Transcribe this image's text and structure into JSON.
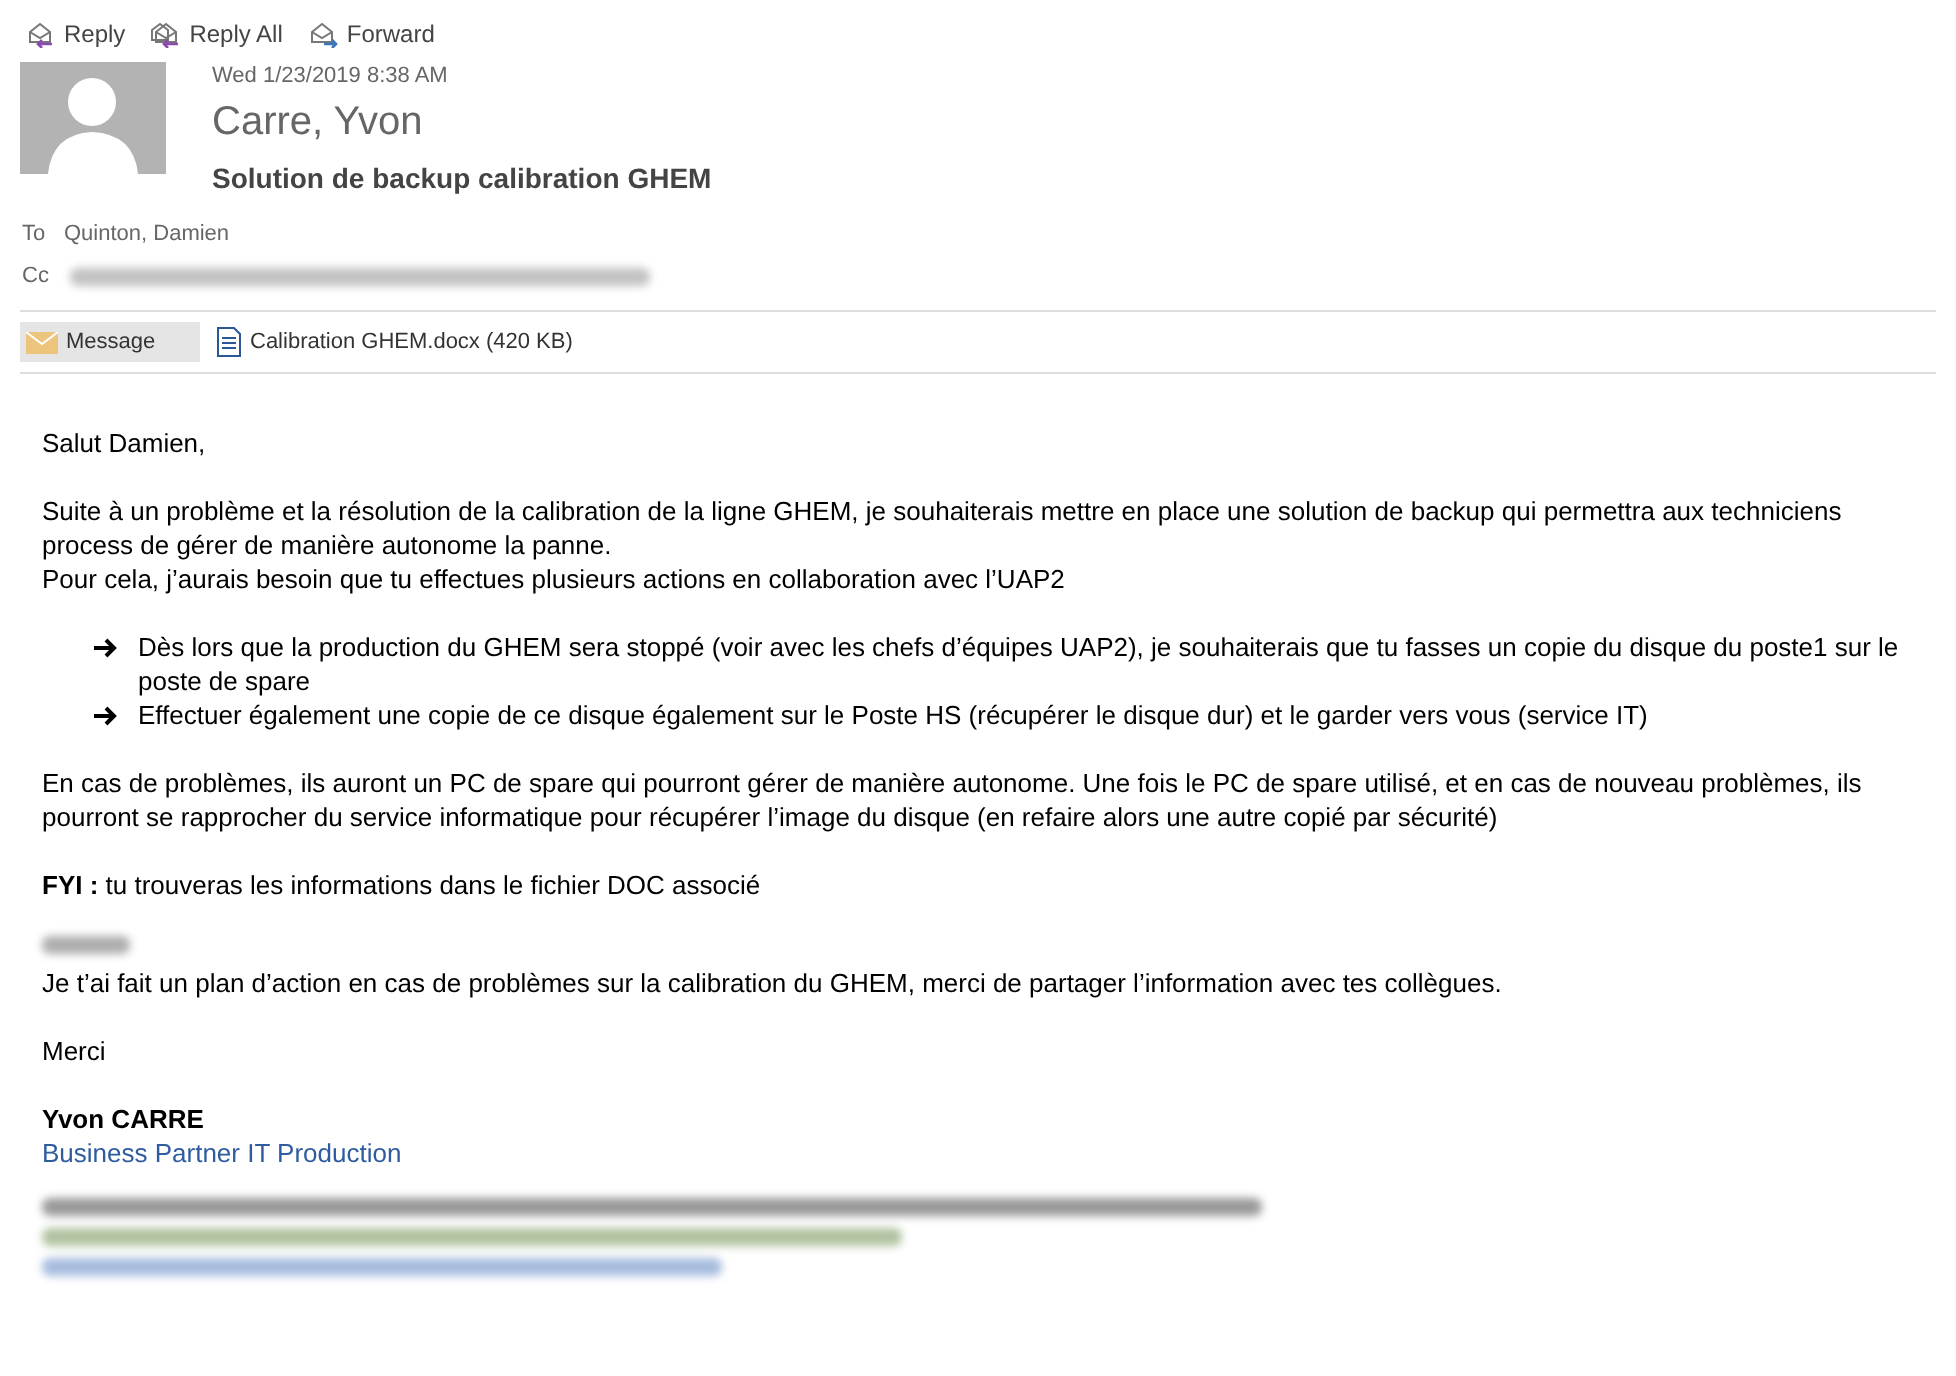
{
  "toolbar": [
    {
      "label": "Reply",
      "kind": "reply"
    },
    {
      "label": "Reply All",
      "kind": "reply_all"
    },
    {
      "label": "Forward",
      "kind": "forward"
    }
  ],
  "header": {
    "date": "Wed 1/23/2019 8:38 AM",
    "sender": "Carre, Yvon",
    "subject": "Solution de backup calibration GHEM",
    "to_label": "To",
    "to": "Quinton, Damien",
    "cc_label": "Cc"
  },
  "attachments": [
    {
      "label": "Message",
      "kind": "message",
      "selected": true
    },
    {
      "label": "Calibration GHEM.docx (420 KB)",
      "kind": "document",
      "selected": false
    }
  ],
  "body": [
    {
      "kind": "para",
      "text": "Salut Damien,"
    },
    {
      "kind": "para",
      "text": "Suite à un problème et la résolution de la calibration de la ligne GHEM, je souhaiterais mettre en place une solution de backup qui permettra aux techniciens process de gérer de manière autonome la panne.\nPour cela, j’aurais besoin que tu effectues plusieurs actions en collaboration avec l’UAP2"
    },
    {
      "kind": "bullets",
      "items": [
        "Dès lors que la production du GHEM sera stoppé (voir avec les chefs d’équipes UAP2), je souhaiterais que tu fasses un copie du disque du poste1 sur le poste de spare",
        "Effectuer également une copie de ce disque également sur le Poste HS (récupérer le disque dur) et le garder vers vous (service IT)"
      ]
    },
    {
      "kind": "para",
      "text": "En cas de problèmes, ils auront un PC de spare qui pourront gérer de manière autonome. Une fois le PC de spare utilisé, et en cas de nouveau problèmes, ils pourront se rapprocher du service informatique pour récupérer l’image du disque (en refaire alors une autre copié par sécurité)"
    },
    {
      "kind": "para",
      "text": "**FYI :** tu trouveras les informations dans le fichier DOC associé"
    },
    {
      "kind": "redacted_para",
      "text": "Je t’ai fait un plan d’action en cas de problèmes sur la calibration du GHEM, merci de partager l’information avec tes collègues."
    },
    {
      "kind": "para",
      "text": "Merci"
    }
  ],
  "signature": {
    "name": "Yvon CARRE",
    "role": "Business Partner IT Production"
  }
}
